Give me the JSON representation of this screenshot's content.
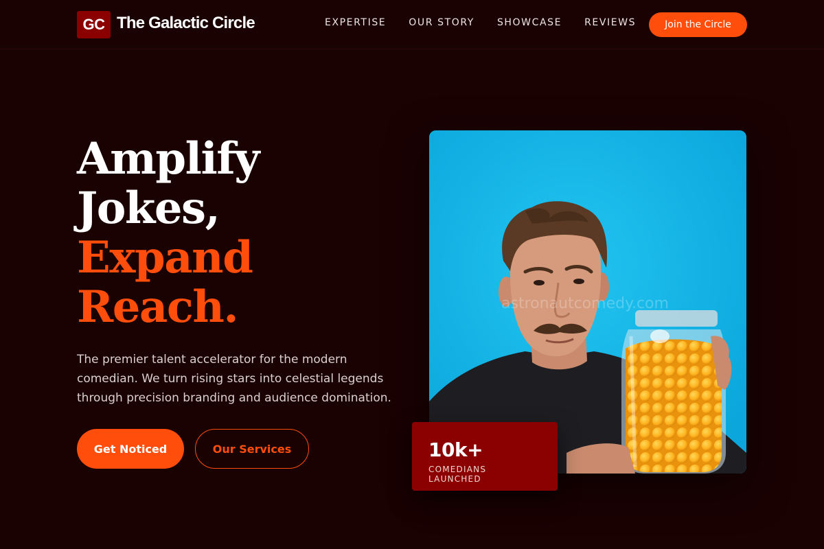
{
  "brand": {
    "logo_text": "GC",
    "name": "The Galactic Circle"
  },
  "nav": {
    "links": [
      "EXPERTISE",
      "OUR STORY",
      "SHOWCASE",
      "REVIEWS"
    ],
    "cta_label": "Join the Circle"
  },
  "hero": {
    "title_lines": [
      "Amplify",
      "Jokes,",
      "Expand",
      "Reach."
    ],
    "description": "The premier talent accelerator for the modern comedian. We turn rising stars into celestial legends through precision branding and audience domination.",
    "primary_button": "Get Noticed",
    "secondary_button": "Our Services",
    "image_watermark": "astronautcomedy.com"
  },
  "stat": {
    "value": "10k+",
    "label": "COMEDIANS LAUNCHED"
  },
  "colors": {
    "background": "#1a0203",
    "accent": "#ff4d0c",
    "brand_red": "#8b0000",
    "image_bg": "#10b4e6"
  },
  "icons": {
    "logo": "gc-monogram-icon"
  }
}
